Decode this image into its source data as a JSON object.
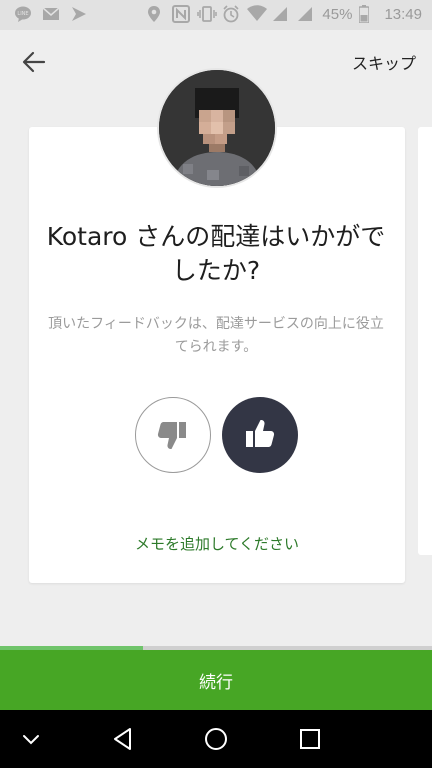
{
  "status_bar": {
    "battery_percent": "45%",
    "time": "13:49",
    "icons": [
      "line-icon",
      "mail-icon",
      "arrow-app-icon",
      "location-icon",
      "nfc-icon",
      "vibrate-icon",
      "alarm-icon",
      "wifi-icon",
      "signal-icon",
      "signal-icon",
      "battery-icon"
    ]
  },
  "header": {
    "back_icon": "arrow-left-icon",
    "skip_label": "スキップ"
  },
  "card": {
    "question": "Kotaro さんの配達はいかがでしたか?",
    "description": "頂いたフィードバックは、配達サービスの向上に役立てられます。",
    "thumbs_down_icon": "thumbs-down-icon",
    "thumbs_up_icon": "thumbs-up-icon",
    "selected": "thumbs-up",
    "memo_link": "メモを追加してください"
  },
  "progress": {
    "fraction": 0.33
  },
  "continue_label": "続行",
  "colors": {
    "accent_green": "#47a625",
    "memo_green": "#2d7a2a",
    "selected_dark": "#333645",
    "progress_fill": "#6fc46a"
  },
  "nav_bar": {
    "icons": [
      "chevron-down-icon",
      "back-triangle-icon",
      "home-circle-icon",
      "recents-square-icon"
    ]
  }
}
